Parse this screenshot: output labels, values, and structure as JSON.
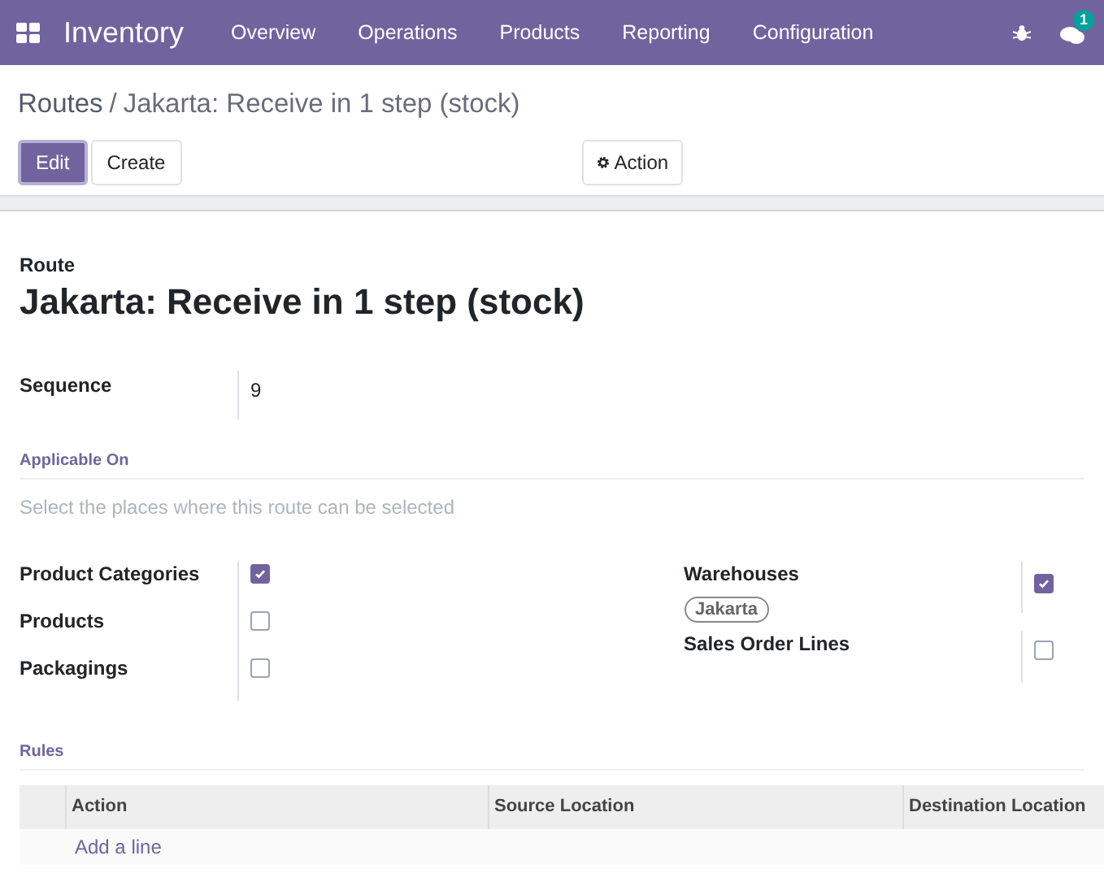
{
  "navbar": {
    "app_name": "Inventory",
    "menu": [
      "Overview",
      "Operations",
      "Products",
      "Reporting",
      "Configuration"
    ],
    "messages_count": "1"
  },
  "breadcrumb": {
    "parent": "Routes",
    "separator": "/",
    "current": "Jakarta: Receive in 1 step (stock)"
  },
  "buttons": [
    {
      "label": "Edit",
      "kind": "primary"
    },
    {
      "label": "Create",
      "kind": "secondary"
    }
  ],
  "action_button": {
    "label": "Action"
  },
  "form": {
    "name_label": "Route",
    "name": "Jakarta: Receive in 1 step (stock)",
    "sequence": {
      "label": "Sequence",
      "value": "9"
    },
    "applicable_on": {
      "title": "Applicable On",
      "help": "Select the places where this route can be selected",
      "left": [
        {
          "label": "Product Categories",
          "checked": true
        },
        {
          "label": "Products",
          "checked": false
        },
        {
          "label": "Packagings",
          "checked": false
        }
      ],
      "right": [
        {
          "label": "Warehouses",
          "checked": true,
          "tags": [
            "Jakarta"
          ]
        },
        {
          "label": "Sales Order Lines",
          "checked": false
        }
      ]
    },
    "rules": {
      "title": "Rules",
      "columns": [
        "Action",
        "Source Location",
        "Destination Location"
      ],
      "add_line": "Add a line"
    }
  }
}
